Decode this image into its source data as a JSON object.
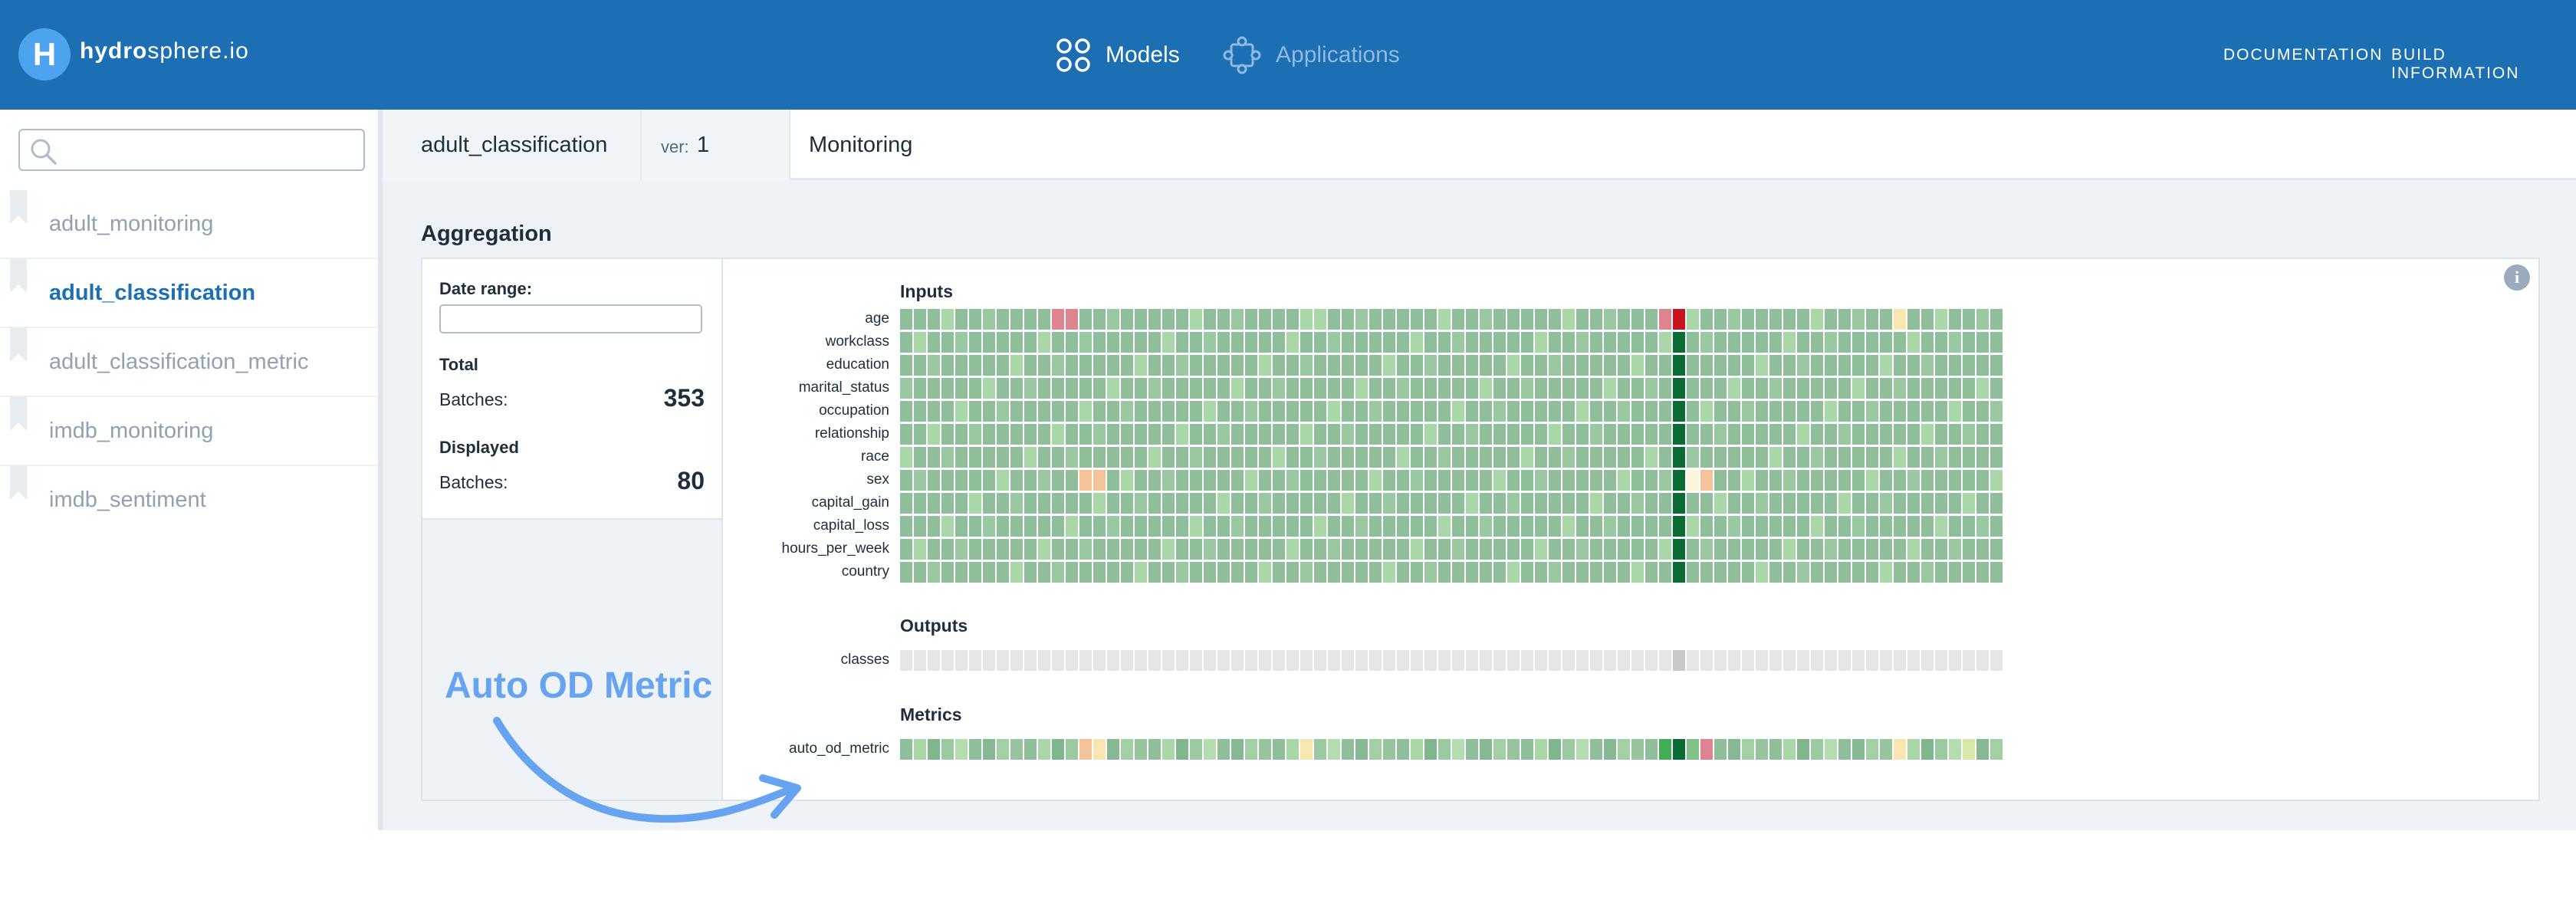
{
  "header": {
    "brand_bold": "hydro",
    "brand_rest": "sphere.io",
    "nav": [
      {
        "label": "Models",
        "icon": "models-icon",
        "active": true
      },
      {
        "label": "Applications",
        "icon": "applications-icon",
        "active": false
      }
    ],
    "links": [
      "DOCUMENTATION",
      "BUILD INFORMATION"
    ]
  },
  "sidebar": {
    "search_placeholder": "",
    "items": [
      {
        "label": "adult_monitoring",
        "selected": false
      },
      {
        "label": "adult_classification",
        "selected": true
      },
      {
        "label": "adult_classification_metric",
        "selected": false
      },
      {
        "label": "imdb_monitoring",
        "selected": false
      },
      {
        "label": "imdb_sentiment",
        "selected": false
      }
    ]
  },
  "breadcrumb": {
    "model": "adult_classification",
    "version_prefix": "ver:",
    "version": "1",
    "page": "Monitoring"
  },
  "aggregation": {
    "title": "Aggregation",
    "date_range_label": "Date range:",
    "total_label": "Total",
    "total_batches_label": "Batches:",
    "total_batches": "353",
    "displayed_label": "Displayed",
    "displayed_batches_label": "Batches:",
    "displayed_batches": "80"
  },
  "heatmap": {
    "inputs_title": "Inputs",
    "outputs_title": "Outputs",
    "metrics_title": "Metrics",
    "columns": 80,
    "inputs": [
      {
        "label": "age",
        "special": {
          "11": "red-light",
          "12": "red-light",
          "29": "green-light",
          "55": "red-light",
          "56": "red-dark",
          "72": "yellow"
        }
      },
      {
        "label": "workclass",
        "special": {
          "56": "green-dark"
        }
      },
      {
        "label": "education",
        "special": {
          "56": "green-dark"
        }
      },
      {
        "label": "marital_status",
        "special": {
          "56": "green-dark"
        }
      },
      {
        "label": "occupation",
        "special": {
          "56": "green-dark"
        }
      },
      {
        "label": "relationship",
        "special": {
          "56": "green-dark"
        }
      },
      {
        "label": "race",
        "special": {
          "56": "green-dark"
        }
      },
      {
        "label": "sex",
        "special": {
          "13": "orange-light",
          "14": "orange-light",
          "56": "green-dark",
          "57": "yellow-white",
          "58": "orange-light"
        }
      },
      {
        "label": "capital_gain",
        "special": {
          "56": "green-dark"
        }
      },
      {
        "label": "capital_loss",
        "special": {
          "56": "green-dark"
        }
      },
      {
        "label": "hours_per_week",
        "special": {
          "56": "green-dark"
        }
      },
      {
        "label": "country",
        "special": {
          "56": "green-dark"
        }
      }
    ],
    "outputs": [
      {
        "label": "classes",
        "special": {
          "56": "gray-dark"
        }
      }
    ],
    "metrics": [
      {
        "label": "auto_od_metric",
        "special": {
          "13": "orange-light",
          "14": "yellow",
          "29": "yellow",
          "55": "green-bright",
          "56": "green-dark",
          "57": "green-mid",
          "58": "red-light",
          "72": "yellow",
          "77": "yellow-green"
        }
      }
    ]
  },
  "annotation": {
    "text": "Auto OD Metric"
  },
  "colors": {
    "header_bg": "#1d6fb4",
    "accent": "#1d6fb4",
    "cell_green": "#8fbf9a",
    "cell_green_light": "#a9d7a8",
    "cell_green_dark": "#0a6b34",
    "cell_red_dark": "#c8141e",
    "cell_red_light": "#de8490",
    "cell_orange_light": "#f5c39a",
    "cell_yellow": "#f7e6b0",
    "cell_gray": "#e5e5e5",
    "annotation": "#66a4f2"
  }
}
